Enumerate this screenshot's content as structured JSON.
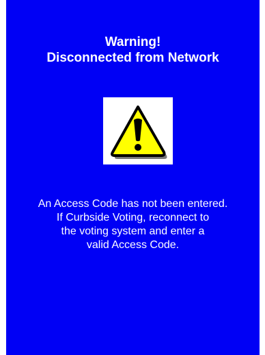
{
  "warning": {
    "title_line1": "Warning!",
    "title_line2": "Disconnected from Network",
    "icon": "warning-triangle-exclamation-icon",
    "message_lines": [
      "An Access Code has not been entered.",
      "If Curbside Voting, reconnect to",
      "the voting system and enter a",
      "valid Access Code."
    ]
  },
  "colors": {
    "background": "#0000F5",
    "text": "#FFFFFF",
    "icon_fill": "#FFFF00",
    "icon_outline": "#000000"
  }
}
